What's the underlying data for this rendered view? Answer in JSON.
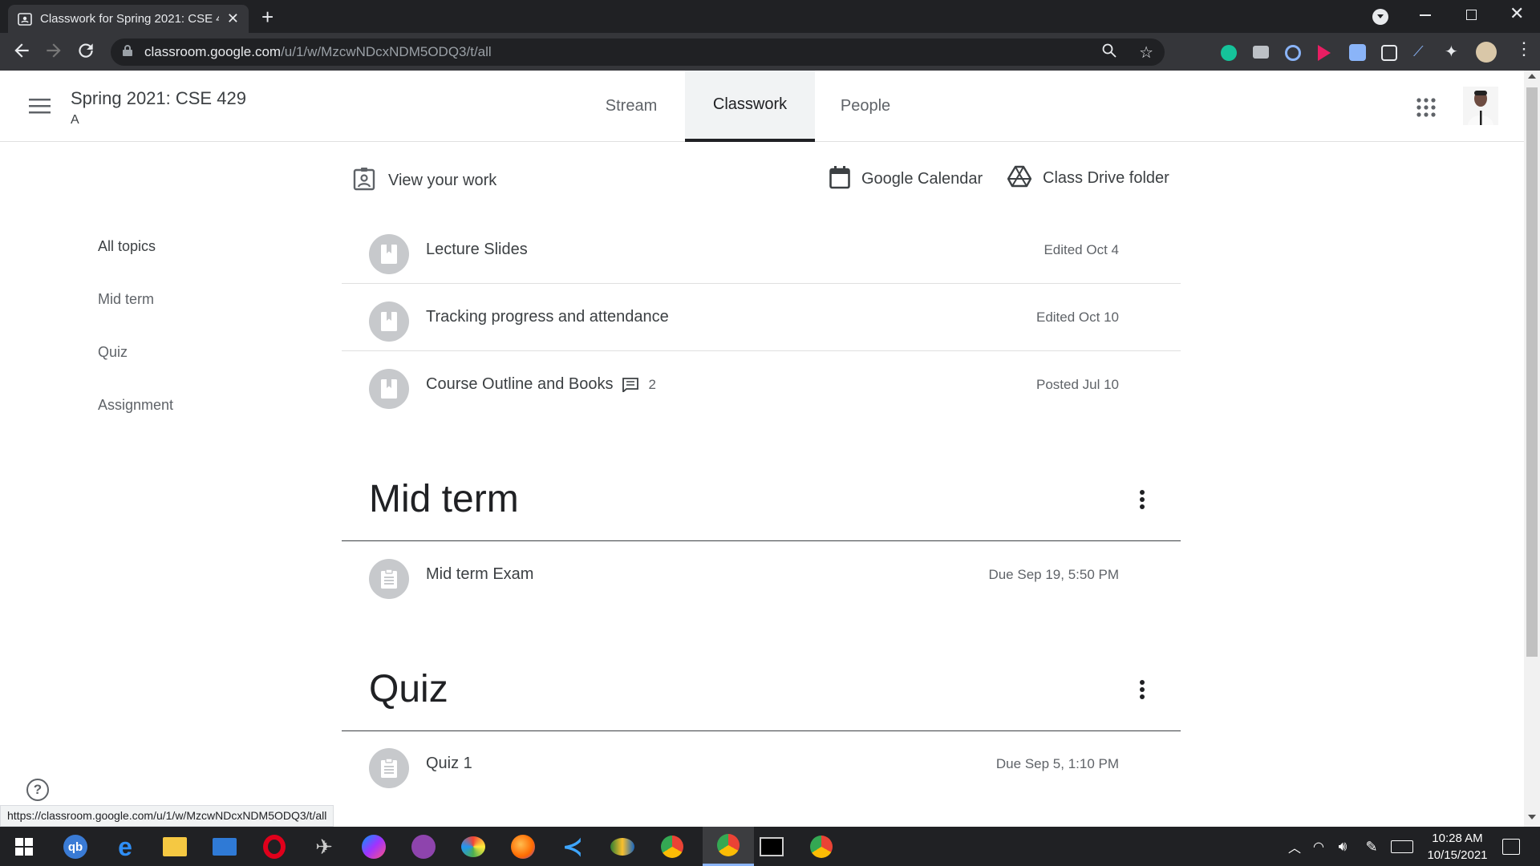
{
  "browser": {
    "tab_title": "Classwork for Spring 2021: CSE 4",
    "url_host": "classroom.google.com",
    "url_path": "/u/1/w/MzcwNDcxNDM5ODQ3/t/all",
    "status_url": "https://classroom.google.com/u/1/w/MzcwNDcxNDM5ODQ3/t/all"
  },
  "header": {
    "class_title": "Spring 2021: CSE 429",
    "class_section": "A",
    "tabs": [
      {
        "label": "Stream"
      },
      {
        "label": "Classwork"
      },
      {
        "label": "People"
      }
    ]
  },
  "actions": {
    "view_work": "View your work",
    "calendar": "Google Calendar",
    "drive": "Class Drive folder"
  },
  "topics": [
    "All topics",
    "Mid term",
    "Quiz",
    "Assignment"
  ],
  "materials": [
    {
      "title": "Lecture Slides",
      "date": "Edited Oct 4"
    },
    {
      "title": "Tracking progress and attendance",
      "date": "Edited Oct 10"
    },
    {
      "title": "Course Outline and Books",
      "comments": "2",
      "date": "Posted Jul 10"
    }
  ],
  "sections": [
    {
      "title": "Mid term",
      "items": [
        {
          "title": "Mid term Exam",
          "date": "Due Sep 19, 5:50 PM"
        }
      ]
    },
    {
      "title": "Quiz",
      "items": [
        {
          "title": "Quiz 1",
          "date": "Due Sep 5, 1:10 PM"
        }
      ]
    }
  ],
  "taskbar": {
    "time": "10:28 AM",
    "date": "10/15/2021"
  },
  "colors": {
    "chrome_dark": "#202124",
    "chrome_toolbar": "#35363a",
    "active_tab_bg": "#f1f3f4",
    "icon_gray": "#c7c9cc"
  }
}
